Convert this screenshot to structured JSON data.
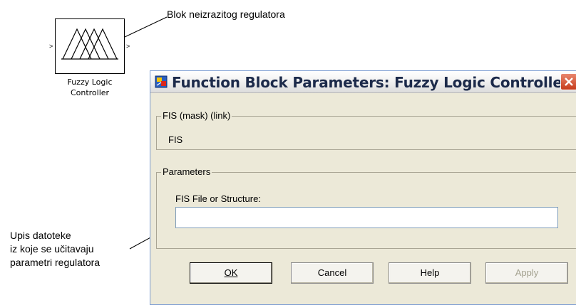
{
  "block": {
    "caption_line1": "Fuzzy Logic",
    "caption_line2": "Controller",
    "input_port": ">",
    "output_port": ">"
  },
  "annotations": {
    "block_label": "Blok neizrazitog regulatora",
    "input_label_line1": "Upis datoteke",
    "input_label_line2": "iz koje se učitavaju",
    "input_label_line3": "parametri regulatora"
  },
  "dialog": {
    "title": "Function Block Parameters: Fuzzy Logic  Controller",
    "close_icon": "close-icon",
    "description_group": {
      "legend": "FIS (mask) (link)",
      "text": "FIS"
    },
    "parameters_group": {
      "legend": "Parameters",
      "field_label": "FIS File or Structure:",
      "field_value": ""
    },
    "buttons": {
      "ok": "OK",
      "cancel": "Cancel",
      "help": "Help",
      "apply": "Apply"
    }
  },
  "colors": {
    "dialog_bg": "#ece9d8",
    "close_button": "#c63b1a"
  }
}
